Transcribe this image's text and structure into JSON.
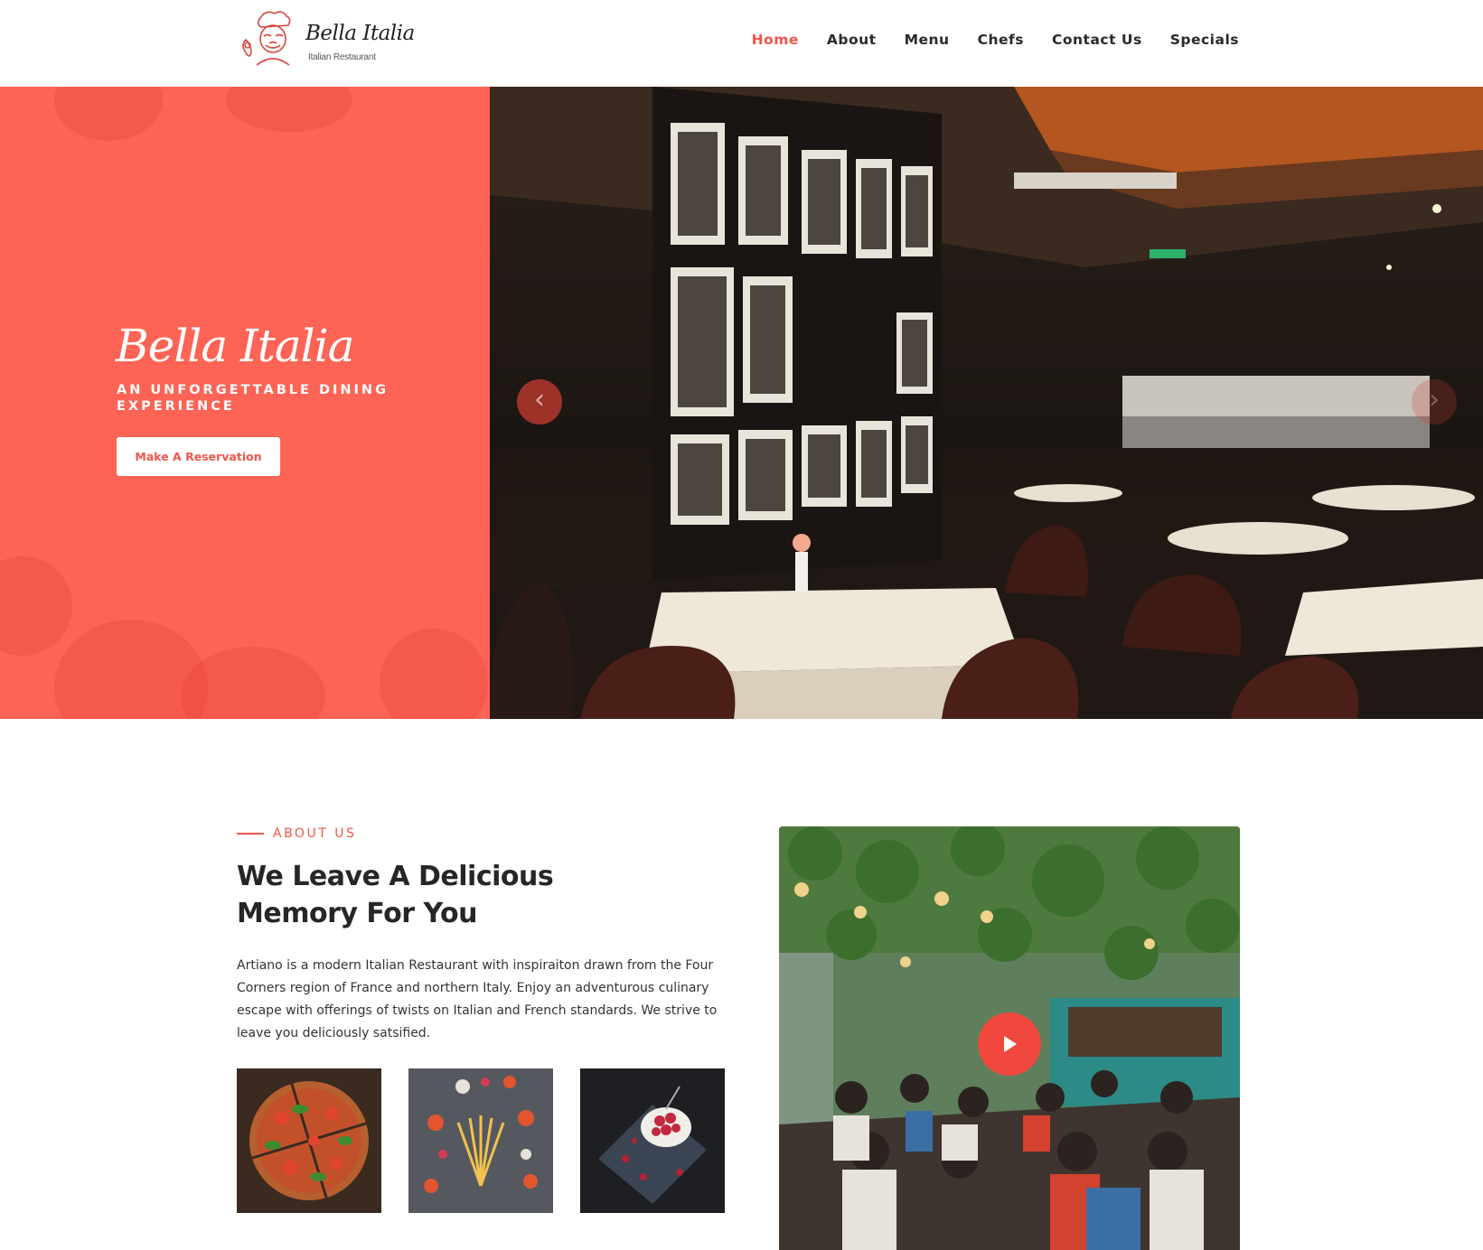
{
  "brand": {
    "logo_script": "Bella Italia",
    "logo_sub": "Italian Restaurant"
  },
  "nav": {
    "items": [
      {
        "label": "Home",
        "active": true
      },
      {
        "label": "About",
        "active": false
      },
      {
        "label": "Menu",
        "active": false
      },
      {
        "label": "Chefs",
        "active": false
      },
      {
        "label": "Contact Us",
        "active": false
      },
      {
        "label": "Specials",
        "active": false
      }
    ]
  },
  "hero": {
    "title": "Bella Italia",
    "subtitle": "AN UNFORGETTABLE DINING EXPERIENCE",
    "cta_label": "Make A Reservation",
    "prev_arrow": "‹",
    "next_arrow": "›"
  },
  "about": {
    "eyebrow": "ABOUT US",
    "heading": "We Leave A Delicious Memory For You",
    "body": "Artiano is a modern Italian Restaurant with inspiraiton drawn from the Four Corners region of France and northern Italy. Enjoy an adventurous culinary escape with offerings of twists on Italian and French standards. We strive to leave you deliciously satsified.",
    "thumbnails": [
      "pizza-photo",
      "pasta-ingredients-photo",
      "raspberry-dessert-photo"
    ]
  },
  "colors": {
    "accent": "#f0574b",
    "hero_panel": "#fd6455",
    "text_dark": "#262626"
  },
  "icons": {
    "play": "play-icon",
    "prev": "chevron-left-icon",
    "next": "chevron-right-icon"
  }
}
